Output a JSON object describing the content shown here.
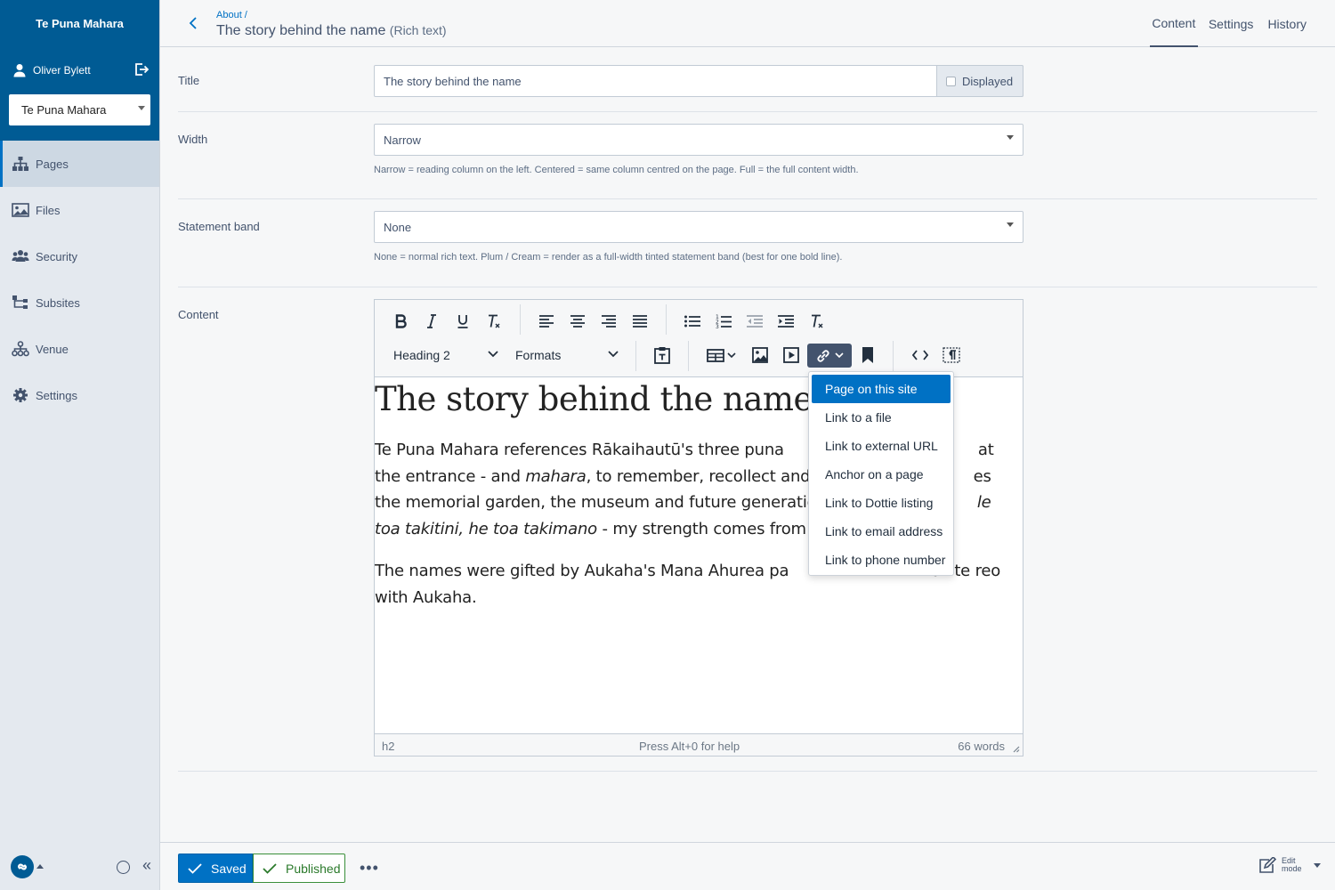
{
  "sidebar": {
    "brand": "Te Puna Mahara",
    "user_name": "Oliver Bylett",
    "site_select": "Te Puna Mahara",
    "items": [
      {
        "label": "Pages"
      },
      {
        "label": "Files"
      },
      {
        "label": "Security"
      },
      {
        "label": "Subsites"
      },
      {
        "label": "Venue"
      },
      {
        "label": "Settings"
      }
    ],
    "collapse_glyph": "«"
  },
  "header": {
    "breadcrumb": "About /",
    "title": "The story behind the name",
    "title_type": "(Rich text)",
    "tabs": [
      "Content",
      "Settings",
      "History"
    ]
  },
  "fields": {
    "title": {
      "label": "Title",
      "value": "The story behind the name",
      "addon": "Displayed"
    },
    "width": {
      "label": "Width",
      "value": "Narrow",
      "help": "Narrow = reading column on the left. Centered = same column centred on the page. Full = the full content width."
    },
    "statement": {
      "label": "Statement band",
      "value": "None",
      "help": "None = normal rich text. Plum / Cream = render as a full-width tinted statement band (best for one bold line)."
    },
    "content": {
      "label": "Content"
    }
  },
  "editor": {
    "block_format": "Heading 2",
    "formats": "Formats",
    "doc": {
      "heading": "The story behind the name",
      "p1_a": "Te Puna Mahara references Rākaihautū's three puna",
      "p1_b": "at the entrance - and ",
      "p1_c": "mahara",
      "p1_d": ", to remember, recollect and re",
      "p1_e": "es the memorial garden, the museum and future generations",
      "p1_f": "le toa takitini, he toa takimano",
      "p1_g": " - my strength comes from ma",
      "p2_a": "The names were gifted by Aukaha's Mana Ahurea pa",
      "p2_b": "all te reo with Aukaha."
    },
    "status": {
      "path": "h2",
      "help": "Press Alt+0 for help",
      "words": "66 words"
    }
  },
  "link_menu": {
    "items": [
      "Page on this site",
      "Link to a file",
      "Link to external URL",
      "Anchor on a page",
      "Link to Dottie listing",
      "Link to email address",
      "Link to phone number"
    ]
  },
  "footer": {
    "saved": "Saved",
    "published": "Published",
    "more": "•••",
    "edit_mode": "Edit mode"
  },
  "colors": {
    "brand": "#005b94",
    "accent": "#0071c4",
    "published": "#2b7a2b",
    "sidebar_bg": "#e4e9ef"
  }
}
